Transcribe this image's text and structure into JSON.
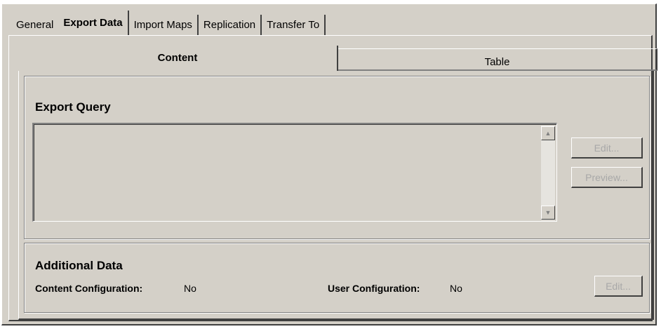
{
  "tabs": [
    {
      "label": "General",
      "active": false
    },
    {
      "label": "Export Data",
      "active": true
    },
    {
      "label": "Import Maps",
      "active": false
    },
    {
      "label": "Replication",
      "active": false
    },
    {
      "label": "Transfer To",
      "active": false
    }
  ],
  "subtabs": {
    "content": "Content",
    "table": "Table"
  },
  "export_query": {
    "title": "Export Query",
    "value": "",
    "edit_label": "Edit...",
    "preview_label": "Preview..."
  },
  "additional_data": {
    "title": "Additional Data",
    "content_config_label": "Content Configuration:",
    "content_config_value": "No",
    "user_config_label": "User Configuration:",
    "user_config_value": "No",
    "edit_label": "Edit..."
  },
  "icons": {
    "scroll_up": "arrow-up-icon",
    "scroll_down": "arrow-down-icon"
  }
}
